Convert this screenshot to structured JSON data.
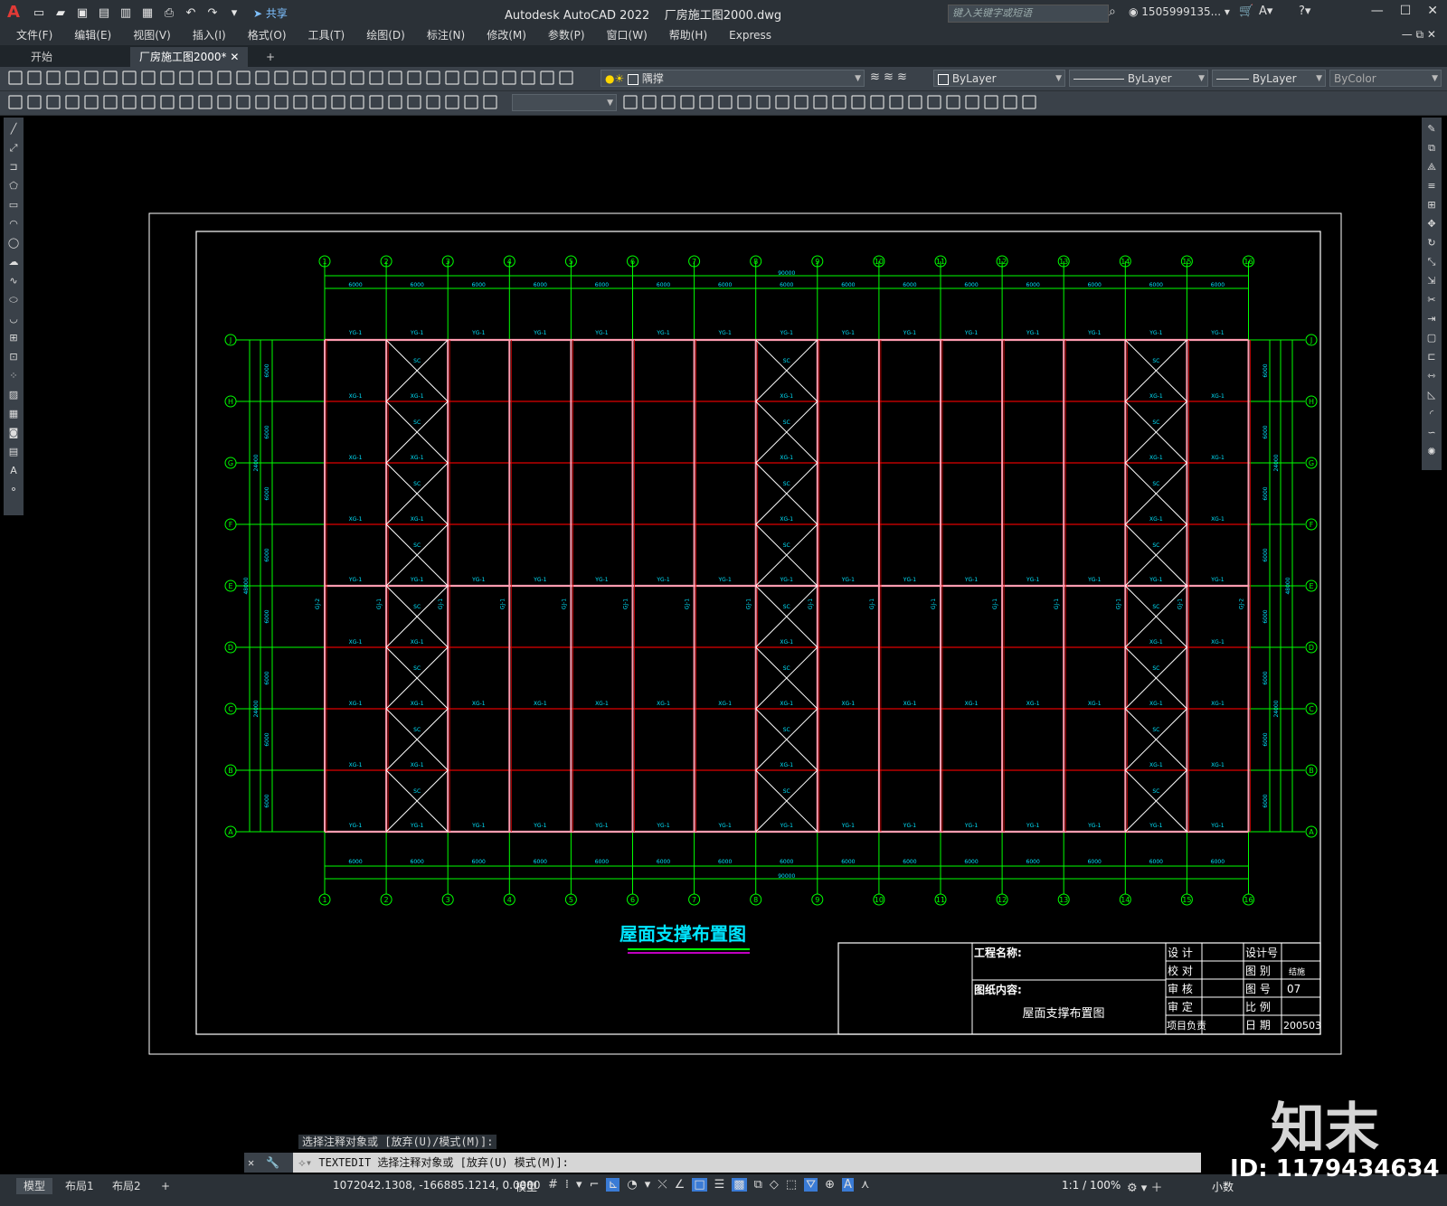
{
  "titlebar": {
    "share_label": "共享",
    "app_title": "Autodesk AutoCAD 2022",
    "file_name": "厂房施工图2000.dwg",
    "search_placeholder": "键入关键字或短语",
    "user": "1505999135..."
  },
  "menu": [
    "文件(F)",
    "编辑(E)",
    "视图(V)",
    "插入(I)",
    "格式(O)",
    "工具(T)",
    "绘图(D)",
    "标注(N)",
    "修改(M)",
    "参数(P)",
    "窗口(W)",
    "帮助(H)",
    "Express"
  ],
  "tabs": {
    "start": "开始",
    "active": "厂房施工图2000*"
  },
  "layers": {
    "layer_name": "隅撑",
    "color": "ByLayer",
    "linetype": "ByLayer",
    "lineweight": "ByLayer",
    "plotstyle": "ByColor"
  },
  "drawing": {
    "column_labels": [
      "1",
      "2",
      "3",
      "4",
      "5",
      "6",
      "7",
      "8",
      "9",
      "10",
      "11",
      "12",
      "13",
      "14",
      "15",
      "16"
    ],
    "row_labels": [
      "J",
      "H",
      "G",
      "F",
      "E",
      "D",
      "C",
      "B",
      "A"
    ],
    "bay_dim": "6000",
    "total_length": "90000",
    "row_dim": "6000",
    "half_width": "24000",
    "total_width": "48000",
    "beam_label": "YG-1",
    "tie_label": "XG-1",
    "brace_label": "SC",
    "column_label": "GJ-1",
    "end_column_label": "GJ-2",
    "title": "屋面支撑布置图"
  },
  "title_block": {
    "project_label": "工程名称:",
    "content_label": "图纸内容:",
    "content_value": "屋面支撑布置图",
    "design": "设  计",
    "check": "校  对",
    "review": "审  核",
    "approve": "审  定",
    "manager": "项目负责",
    "design_no": "设计号",
    "category": "图  别",
    "category_value": "结施",
    "drawing_no": "图  号",
    "drawing_no_value": "07",
    "scale": "比  例",
    "date": "日  期",
    "date_value": "200503"
  },
  "command": {
    "history": "选择注释对象或 [放弃(U)/模式(M)]:",
    "current": "TEXTEDIT 选择注释对象或 [放弃(U) 模式(M)]:"
  },
  "status": {
    "model_tab": "模型",
    "layout1": "布局1",
    "layout2": "布局2",
    "coords": "1072042.1308, -166885.1214, 0.0000",
    "model_label": "模型",
    "scale": "1:1 / 100%",
    "units": "小数"
  },
  "watermark": {
    "logo": "知末",
    "id": "ID: 1179434634"
  },
  "colors": {
    "grid_green": "#00ff00",
    "beam_red": "#e00000",
    "column_pink": "#ff9cb0",
    "label_cyan": "#00e5ff",
    "brace_white": "#ffffff"
  }
}
